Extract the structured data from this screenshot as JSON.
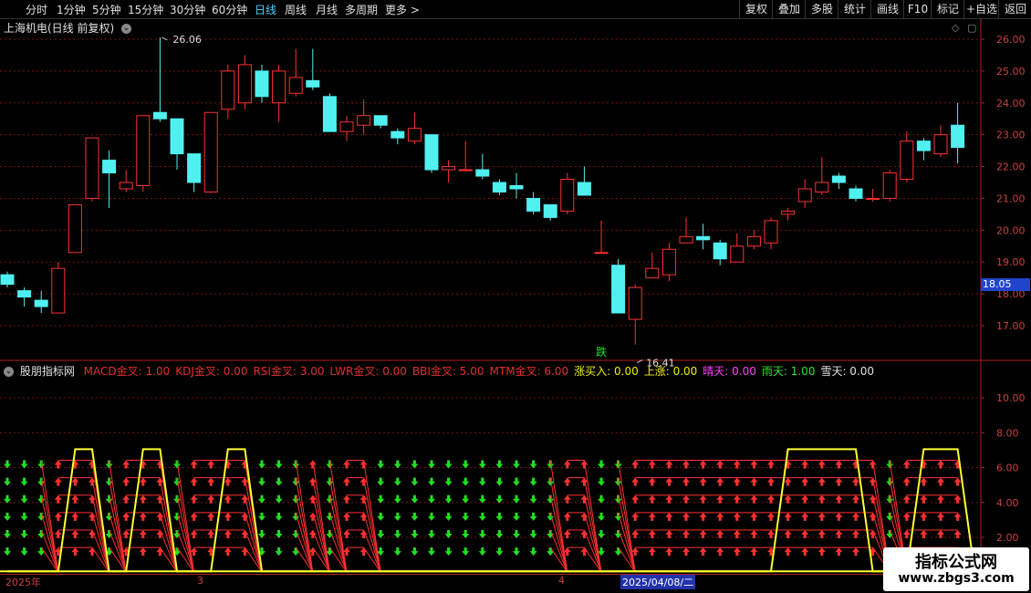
{
  "toolbar": {
    "left_items": [
      "分时",
      "1分钟",
      "5分钟",
      "15分钟",
      "30分钟",
      "60分钟",
      "日线",
      "周线",
      "月线",
      "多周期",
      "更多 >"
    ],
    "active_item": "日线",
    "right_items": [
      "复权",
      "叠加",
      "多股",
      "统计",
      "画线",
      "F10",
      "标记",
      "+自选",
      "返回"
    ]
  },
  "chart_title": "上海机电(日线 前复权)",
  "price_axis_labels": [
    "26.00",
    "25.00",
    "24.00",
    "23.00",
    "22.00",
    "21.00",
    "20.00",
    "19.00",
    "18.00",
    "17.00"
  ],
  "current_price": "18.05",
  "high_annotation": "26.06",
  "low_annotation": "16.41",
  "signal_char": "跌",
  "indicator_name": "股朋指标网",
  "indicator_values": [
    {
      "text": "MACD金叉: 1.00",
      "color": "#e03030"
    },
    {
      "text": "KDJ金叉: 0.00",
      "color": "#e03030"
    },
    {
      "text": "RSI金叉: 3.00",
      "color": "#e03030"
    },
    {
      "text": "LWR金叉: 0.00",
      "color": "#e03030"
    },
    {
      "text": "BBI金叉: 5.00",
      "color": "#e03030"
    },
    {
      "text": "MTM金叉: 6.00",
      "color": "#e03030"
    },
    {
      "text": "涨买入: 0.00",
      "color": "#f0f000"
    },
    {
      "text": "上涨: 0.00",
      "color": "#f0f000"
    },
    {
      "text": "晴天: 0.00",
      "color": "#ff40ff"
    },
    {
      "text": "雨天: 1.00",
      "color": "#30e030"
    },
    {
      "text": "雪天: 0.00",
      "color": "#e0e0e0"
    }
  ],
  "indicator_axis_labels": [
    "10.00",
    "8.00",
    "6.00",
    "4.00",
    "2.00"
  ],
  "date_labels": [
    "2025年",
    "3",
    "4"
  ],
  "selected_date": "2025/04/08/二",
  "watermark": {
    "line1": "指标公式网",
    "line2": "www.zbgs3.com"
  },
  "colors": {
    "up": "#ff3030",
    "down": "#50f0f0",
    "grid": "#7a1010",
    "yellow": "#ffff30",
    "green": "#20e020"
  },
  "chart_data": {
    "type": "candlestick",
    "ylim": [
      16.0,
      26.5
    ],
    "candles": [
      {
        "o": 18.6,
        "c": 18.3,
        "h": 18.7,
        "l": 18.2
      },
      {
        "o": 18.1,
        "c": 17.9,
        "h": 18.2,
        "l": 17.6
      },
      {
        "o": 17.8,
        "c": 17.6,
        "h": 18.1,
        "l": 17.4
      },
      {
        "o": 17.4,
        "c": 18.8,
        "h": 19.0,
        "l": 17.4
      },
      {
        "o": 19.3,
        "c": 20.8,
        "h": 20.8,
        "l": 19.3
      },
      {
        "o": 21.0,
        "c": 22.9,
        "h": 22.9,
        "l": 20.9
      },
      {
        "o": 22.2,
        "c": 21.8,
        "h": 22.5,
        "l": 20.7
      },
      {
        "o": 21.3,
        "c": 21.5,
        "h": 21.9,
        "l": 21.2
      },
      {
        "o": 21.4,
        "c": 23.6,
        "h": 23.6,
        "l": 21.2
      },
      {
        "o": 23.7,
        "c": 23.5,
        "h": 26.06,
        "l": 23.4
      },
      {
        "o": 23.5,
        "c": 22.4,
        "h": 23.5,
        "l": 21.9
      },
      {
        "o": 22.4,
        "c": 21.5,
        "h": 22.4,
        "l": 21.2
      },
      {
        "o": 21.2,
        "c": 23.7,
        "h": 23.7,
        "l": 21.2
      },
      {
        "o": 23.8,
        "c": 25.0,
        "h": 25.2,
        "l": 23.5
      },
      {
        "o": 24.0,
        "c": 25.2,
        "h": 25.5,
        "l": 23.8
      },
      {
        "o": 25.0,
        "c": 24.2,
        "h": 25.2,
        "l": 24.0
      },
      {
        "o": 24.0,
        "c": 25.0,
        "h": 25.2,
        "l": 23.4
      },
      {
        "o": 24.3,
        "c": 24.8,
        "h": 25.7,
        "l": 24.2
      },
      {
        "o": 24.7,
        "c": 24.5,
        "h": 25.7,
        "l": 24.4
      },
      {
        "o": 24.2,
        "c": 23.1,
        "h": 24.3,
        "l": 23.1
      },
      {
        "o": 23.1,
        "c": 23.4,
        "h": 23.6,
        "l": 22.8
      },
      {
        "o": 23.3,
        "c": 23.6,
        "h": 24.1,
        "l": 23.0
      },
      {
        "o": 23.6,
        "c": 23.3,
        "h": 23.6,
        "l": 23.2
      },
      {
        "o": 23.1,
        "c": 22.9,
        "h": 23.2,
        "l": 22.7
      },
      {
        "o": 22.8,
        "c": 23.2,
        "h": 23.7,
        "l": 22.7
      },
      {
        "o": 23.0,
        "c": 21.9,
        "h": 23.0,
        "l": 21.8
      },
      {
        "o": 21.9,
        "c": 22.0,
        "h": 22.2,
        "l": 21.5
      },
      {
        "o": 21.9,
        "c": 21.9,
        "h": 22.8,
        "l": 21.9
      },
      {
        "o": 21.9,
        "c": 21.7,
        "h": 22.4,
        "l": 21.6
      },
      {
        "o": 21.5,
        "c": 21.2,
        "h": 21.6,
        "l": 21.1
      },
      {
        "o": 21.4,
        "c": 21.3,
        "h": 21.8,
        "l": 21.0
      },
      {
        "o": 21.0,
        "c": 20.6,
        "h": 21.2,
        "l": 20.5
      },
      {
        "o": 20.8,
        "c": 20.4,
        "h": 20.8,
        "l": 20.3
      },
      {
        "o": 20.6,
        "c": 21.6,
        "h": 21.8,
        "l": 20.5
      },
      {
        "o": 21.5,
        "c": 21.1,
        "h": 22.0,
        "l": 21.1
      },
      {
        "o": 19.3,
        "c": 19.3,
        "h": 20.3,
        "l": 19.3
      },
      {
        "o": 18.9,
        "c": 17.4,
        "h": 19.1,
        "l": 17.4
      },
      {
        "o": 17.2,
        "c": 18.2,
        "h": 18.3,
        "l": 16.41
      },
      {
        "o": 18.5,
        "c": 18.8,
        "h": 19.3,
        "l": 18.5
      },
      {
        "o": 18.6,
        "c": 19.4,
        "h": 19.6,
        "l": 18.4
      },
      {
        "o": 19.6,
        "c": 19.8,
        "h": 20.4,
        "l": 19.6
      },
      {
        "o": 19.8,
        "c": 19.7,
        "h": 20.2,
        "l": 19.4
      },
      {
        "o": 19.6,
        "c": 19.1,
        "h": 19.7,
        "l": 18.9
      },
      {
        "o": 19.0,
        "c": 19.5,
        "h": 19.9,
        "l": 19.0
      },
      {
        "o": 19.5,
        "c": 19.8,
        "h": 20.0,
        "l": 19.4
      },
      {
        "o": 19.6,
        "c": 20.3,
        "h": 20.4,
        "l": 19.4
      },
      {
        "o": 20.5,
        "c": 20.6,
        "h": 20.7,
        "l": 20.3
      },
      {
        "o": 20.9,
        "c": 21.3,
        "h": 21.6,
        "l": 20.7
      },
      {
        "o": 21.2,
        "c": 21.5,
        "h": 22.3,
        "l": 21.1
      },
      {
        "o": 21.7,
        "c": 21.5,
        "h": 21.8,
        "l": 21.3
      },
      {
        "o": 21.3,
        "c": 21.0,
        "h": 21.4,
        "l": 20.9
      },
      {
        "o": 21.0,
        "c": 21.0,
        "h": 21.3,
        "l": 20.9
      },
      {
        "o": 21.0,
        "c": 21.8,
        "h": 21.9,
        "l": 20.9
      },
      {
        "o": 21.6,
        "c": 22.8,
        "h": 23.1,
        "l": 21.5
      },
      {
        "o": 22.8,
        "c": 22.5,
        "h": 22.9,
        "l": 22.2
      },
      {
        "o": 22.4,
        "c": 23.0,
        "h": 23.3,
        "l": 22.3
      },
      {
        "o": 23.3,
        "c": 22.6,
        "h": 24.0,
        "l": 22.1
      }
    ],
    "indicator": {
      "ylim": [
        0,
        12
      ],
      "yellow_line": [
        0,
        0,
        0,
        0,
        7,
        7,
        0,
        0,
        7,
        7,
        0,
        0,
        0,
        7,
        7,
        0,
        0,
        0,
        0,
        0,
        0,
        0,
        0,
        0,
        0,
        0,
        0,
        0,
        0,
        0,
        0,
        0,
        0,
        0,
        0,
        0,
        0,
        0,
        0,
        0,
        0,
        0,
        0,
        0,
        0,
        0,
        7,
        7,
        7,
        7,
        7,
        0,
        0,
        0,
        7,
        7,
        7,
        0
      ],
      "arrow_rows": [
        1,
        2,
        3,
        4,
        5,
        6
      ],
      "arrow_up_columns": [
        3,
        4,
        5,
        7,
        8,
        9,
        11,
        12,
        13,
        14,
        18,
        20,
        21,
        33,
        34,
        37,
        38,
        39,
        40,
        41,
        42,
        43,
        44,
        45,
        46,
        47,
        48,
        49,
        50,
        51,
        53,
        54,
        55,
        56
      ]
    }
  }
}
